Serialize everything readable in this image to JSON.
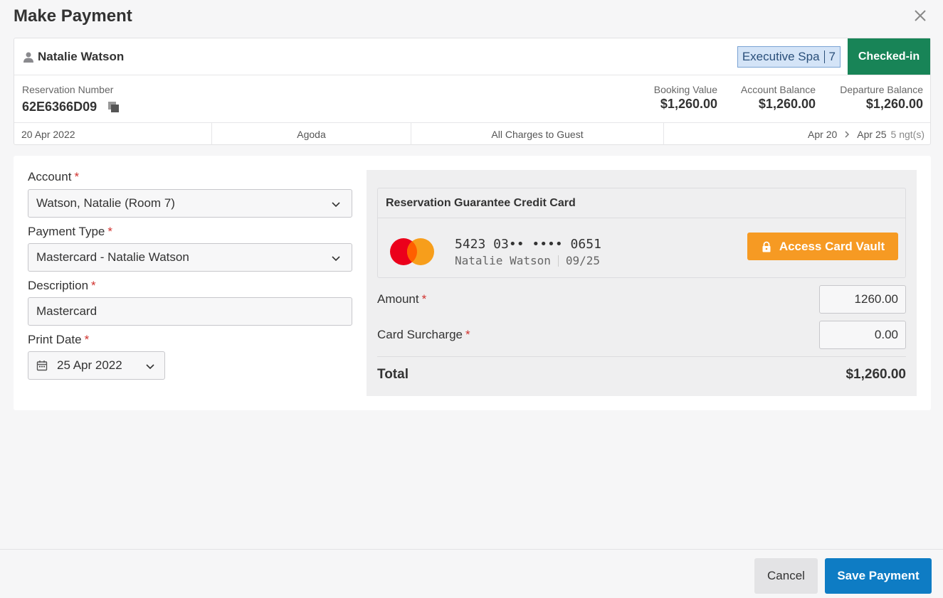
{
  "dialog": {
    "title": "Make Payment",
    "close_icon": "close-icon"
  },
  "reservation": {
    "guest_name": "Natalie Watson",
    "room_type": "Executive Spa",
    "room_number": "7",
    "status": "Checked-in",
    "number_label": "Reservation Number",
    "number": "62E6366D09",
    "booking_value_label": "Booking Value",
    "booking_value": "$1,260.00",
    "account_balance_label": "Account Balance",
    "account_balance": "$1,260.00",
    "departure_balance_label": "Departure Balance",
    "departure_balance": "$1,260.00",
    "booked_date": "20 Apr 2022",
    "channel": "Agoda",
    "billing": "All Charges to Guest",
    "arrival": "Apr 20",
    "departure": "Apr 25",
    "nights": "5 ngt(s)"
  },
  "form": {
    "account_label": "Account",
    "account_value": "Watson, Natalie (Room 7)",
    "payment_type_label": "Payment Type",
    "payment_type_value": "Mastercard - Natalie Watson",
    "description_label": "Description",
    "description_value": "Mastercard",
    "print_date_label": "Print Date",
    "print_date_value": "25 Apr 2022",
    "required_mark": "*"
  },
  "card": {
    "section_title": "Reservation Guarantee Credit Card",
    "number": "5423 03•• •••• 0651",
    "holder": "Natalie Watson",
    "expiry": "09/25",
    "vault_button": "Access Card Vault"
  },
  "amounts": {
    "amount_label": "Amount",
    "amount_value": "1260.00",
    "surcharge_label": "Card Surcharge",
    "surcharge_value": "0.00",
    "total_label": "Total",
    "total_value": "$1,260.00"
  },
  "footer": {
    "cancel_label": "Cancel",
    "save_label": "Save Payment"
  },
  "colors": {
    "status_green": "#188457",
    "vault_orange": "#f69a23",
    "primary_blue": "#0e7cc4",
    "required_red": "#d0312d"
  }
}
